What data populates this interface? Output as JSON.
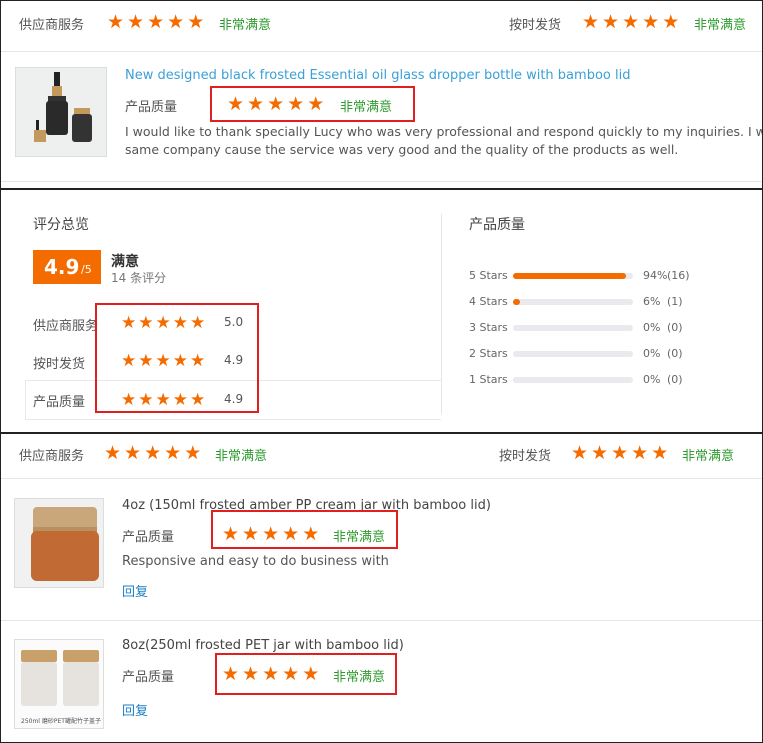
{
  "panel_top": {
    "supplier_service_label": "供应商服务",
    "supplier_service_rating_text": "非常满意",
    "on_time_label": "按时发货",
    "on_time_rating_text": "非常满意",
    "review": {
      "product_title": "New designed black frosted Essential oil glass dropper bottle with bamboo lid",
      "quality_label": "产品质量",
      "quality_rating_text": "非常满意",
      "comment_line1": "I would like to thank specially Lucy who was very professional and respond quickly to my inquiries. I will",
      "comment_line2": "same company cause the service was very good and the quality of the products as well."
    }
  },
  "panel_summary": {
    "title": "评分总览",
    "score": "4.9",
    "score_max": "/5",
    "satisfaction": "满意",
    "review_count": "14 条评分",
    "dimensions": [
      {
        "label": "供应商服务",
        "value": "5.0"
      },
      {
        "label": "按时发货",
        "value": "4.9"
      },
      {
        "label": "产品质量",
        "value": "4.9"
      }
    ],
    "quality_title": "产品质量",
    "breakdown": [
      {
        "label": "5 Stars",
        "percent": 94,
        "percent_text": "94%",
        "count": "(16)"
      },
      {
        "label": "4 Stars",
        "percent": 6,
        "percent_text": "6%",
        "count": "(1)"
      },
      {
        "label": "3 Stars",
        "percent": 0,
        "percent_text": "0%",
        "count": "(0)"
      },
      {
        "label": "2 Stars",
        "percent": 0,
        "percent_text": "0%",
        "count": "(0)"
      },
      {
        "label": "1 Stars",
        "percent": 0,
        "percent_text": "0%",
        "count": "(0)"
      }
    ],
    "accent_color": "#f46b00"
  },
  "panel_bottom": {
    "supplier_service_label": "供应商服务",
    "supplier_service_rating_text": "非常满意",
    "on_time_label": "按时发货",
    "on_time_rating_text": "非常满意",
    "reviews": [
      {
        "product_title": "4oz (150ml frosted amber PP cream jar with bamboo lid)",
        "quality_label": "产品质量",
        "quality_rating_text": "非常满意",
        "comment": "Responsive and easy to do business with",
        "reply_label": "回复"
      },
      {
        "product_title": "8oz(250ml frosted PET jar with bamboo lid)",
        "quality_label": "产品质量",
        "quality_rating_text": "非常满意",
        "reply_label": "回复",
        "image_caption": "250ml 磨砂PET罐配竹子盖子"
      }
    ]
  }
}
